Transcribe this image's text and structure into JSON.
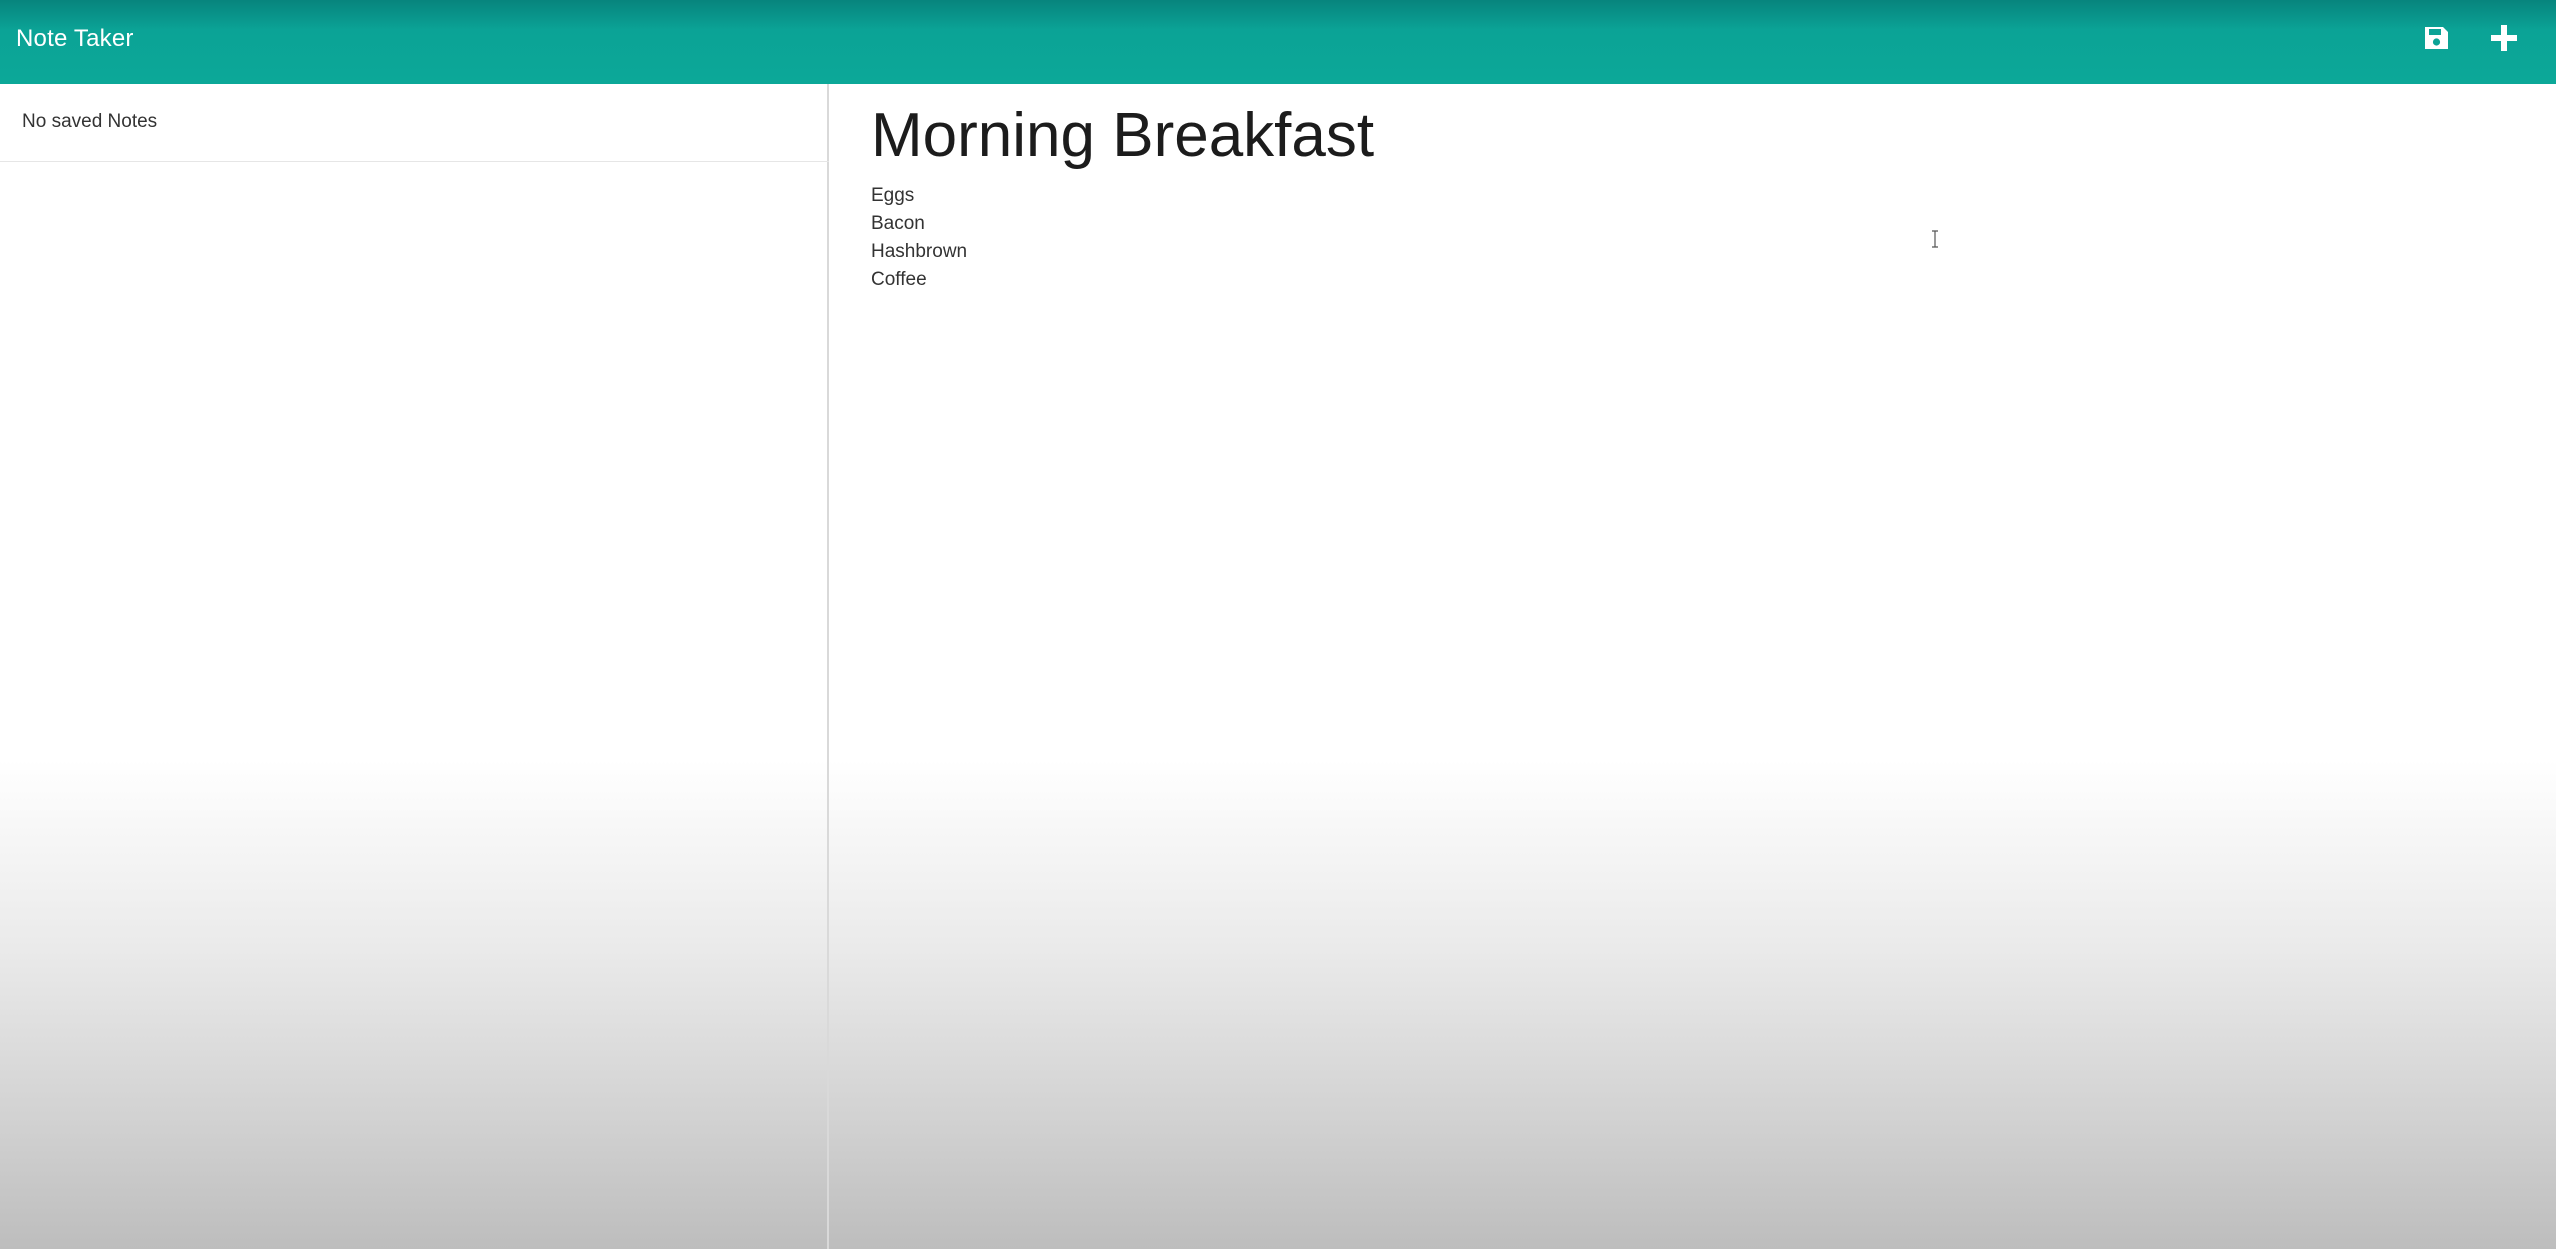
{
  "navbar": {
    "brand": "Note Taker",
    "save_icon": "save-icon",
    "new_icon": "plus-icon",
    "color": "#0ba396"
  },
  "sidebar": {
    "empty_message": "No saved Notes"
  },
  "editor": {
    "title": "Morning Breakfast",
    "body_lines": [
      "Eggs",
      "Bacon",
      "Hashbrown",
      "Coffee"
    ]
  }
}
